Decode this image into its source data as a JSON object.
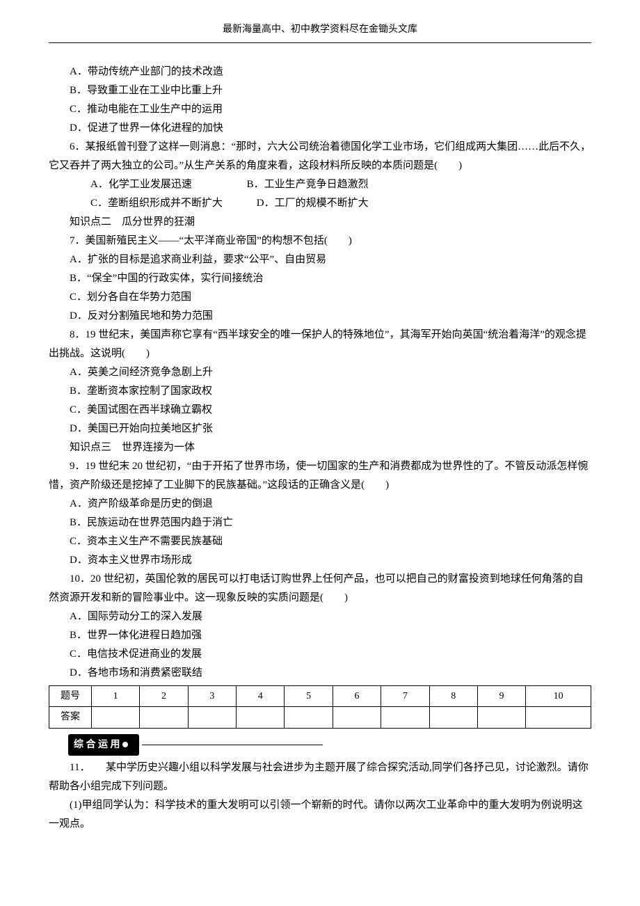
{
  "header": "最新海量高中、初中教学资料尽在金锄头文库",
  "q5": {
    "a": "A．带动传统产业部门的技术改造",
    "b": "B．导致重工业在工业中比重上升",
    "c": "C．推动电能在工业生产中的运用",
    "d": "D．促进了世界一体化进程的加快"
  },
  "q6": {
    "stem": "6．某报纸曾刊登了这样一则消息：“那时，六大公司统治着德国化学工业市场，它们组成两大集团……此后不久，它又吞并了两大独立的公司。”从生产关系的角度来看，这段材料所反映的本质问题是(　　)",
    "a": "A．化学工业发展迅速",
    "b": "B．工业生产竞争日趋激烈",
    "c": "C．垄断组织形成并不断扩大",
    "d": "D．工厂的规模不断扩大"
  },
  "kp2": "知识点二　瓜分世界的狂潮",
  "q7": {
    "stem": "7．美国新殖民主义——“太平洋商业帝国”的构想不包括(　　)",
    "a": "A．扩张的目标是追求商业利益，要求“公平”、自由贸易",
    "b": "B．“保全”中国的行政实体，实行间接统治",
    "c": "C．划分各自在华势力范围",
    "d": "D．反对分割殖民地和势力范围"
  },
  "q8": {
    "stem": "8．19 世纪末，美国声称它享有“西半球安全的唯一保护人的特殊地位”，其海军开始向英国“统治着海洋”的观念提出挑战。这说明(　　)",
    "a": "A．英美之间经济竞争急剧上升",
    "b": "B．垄断资本家控制了国家政权",
    "c": "C．美国试图在西半球确立霸权",
    "d": "D．美国已开始向拉美地区扩张"
  },
  "kp3": "知识点三　世界连接为一体",
  "q9": {
    "stem": "9．19 世纪末 20 世纪初，“由于开拓了世界市场，使一切国家的生产和消费都成为世界性的了。不管反动派怎样惋惜，资产阶级还是挖掉了工业脚下的民族基础。”这段话的正确含义是(　　)",
    "a": "A．资产阶级革命是历史的倒退",
    "b": "B．民族运动在世界范围内趋于消亡",
    "c": "C．资本主义生产不需要民族基础",
    "d": "D．资本主义世界市场形成"
  },
  "q10": {
    "stem": "10．20 世纪初，英国伦敦的居民可以打电话订购世界上任何产品，也可以把自己的财富投资到地球任何角落的自然资源开发和新的冒险事业中。这一现象反映的实质问题是(　　)",
    "a": "A．国际劳动分工的深入发展",
    "b": "B．世界一体化进程日趋加强",
    "c": "C．电信技术促进商业的发展",
    "d": "D．各地市场和消费紧密联结"
  },
  "table": {
    "r1": "题号",
    "r2": "答案",
    "cols": [
      "1",
      "2",
      "3",
      "4",
      "5",
      "6",
      "7",
      "8",
      "9",
      "10"
    ]
  },
  "sectionTag": "综 合 运 用",
  "q11": {
    "stem": "11．　　某中学历史兴趣小组以科学发展与社会进步为主题开展了综合探究活动,同学们各抒己见，讨论激烈。请你帮助各小组完成下列问题。",
    "sub1": "(1)甲组同学认为：科学技术的重大发明可以引领一个崭新的时代。请你以两次工业革命中的重大发明为例说明这一观点。"
  }
}
